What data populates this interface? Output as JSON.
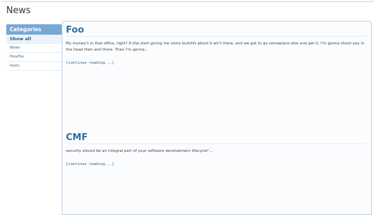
{
  "page": {
    "title": "News"
  },
  "sidebar": {
    "header": "Categories",
    "items": [
      {
        "label": "Show all"
      },
      {
        "label": "News"
      },
      {
        "label": "HowTos"
      },
      {
        "label": "testn"
      }
    ]
  },
  "posts": [
    {
      "title": "Foo",
      "excerpt": "My money's in that office, right? If she start giving me some bullshit about it ain't there, and we got to go someplace else and get it, I'm gonna shoot you in the head then and there. Then I'm gonna...",
      "more_label": "[continue reading...]"
    },
    {
      "title": "CMF",
      "excerpt": "security should be an integral part of your software development lifecycle\"...",
      "more_label": "[continue reading...]"
    }
  ],
  "colors": {
    "accent": "#77a9d3",
    "title_link": "#2f6f9e",
    "border": "#bcd2e5"
  }
}
